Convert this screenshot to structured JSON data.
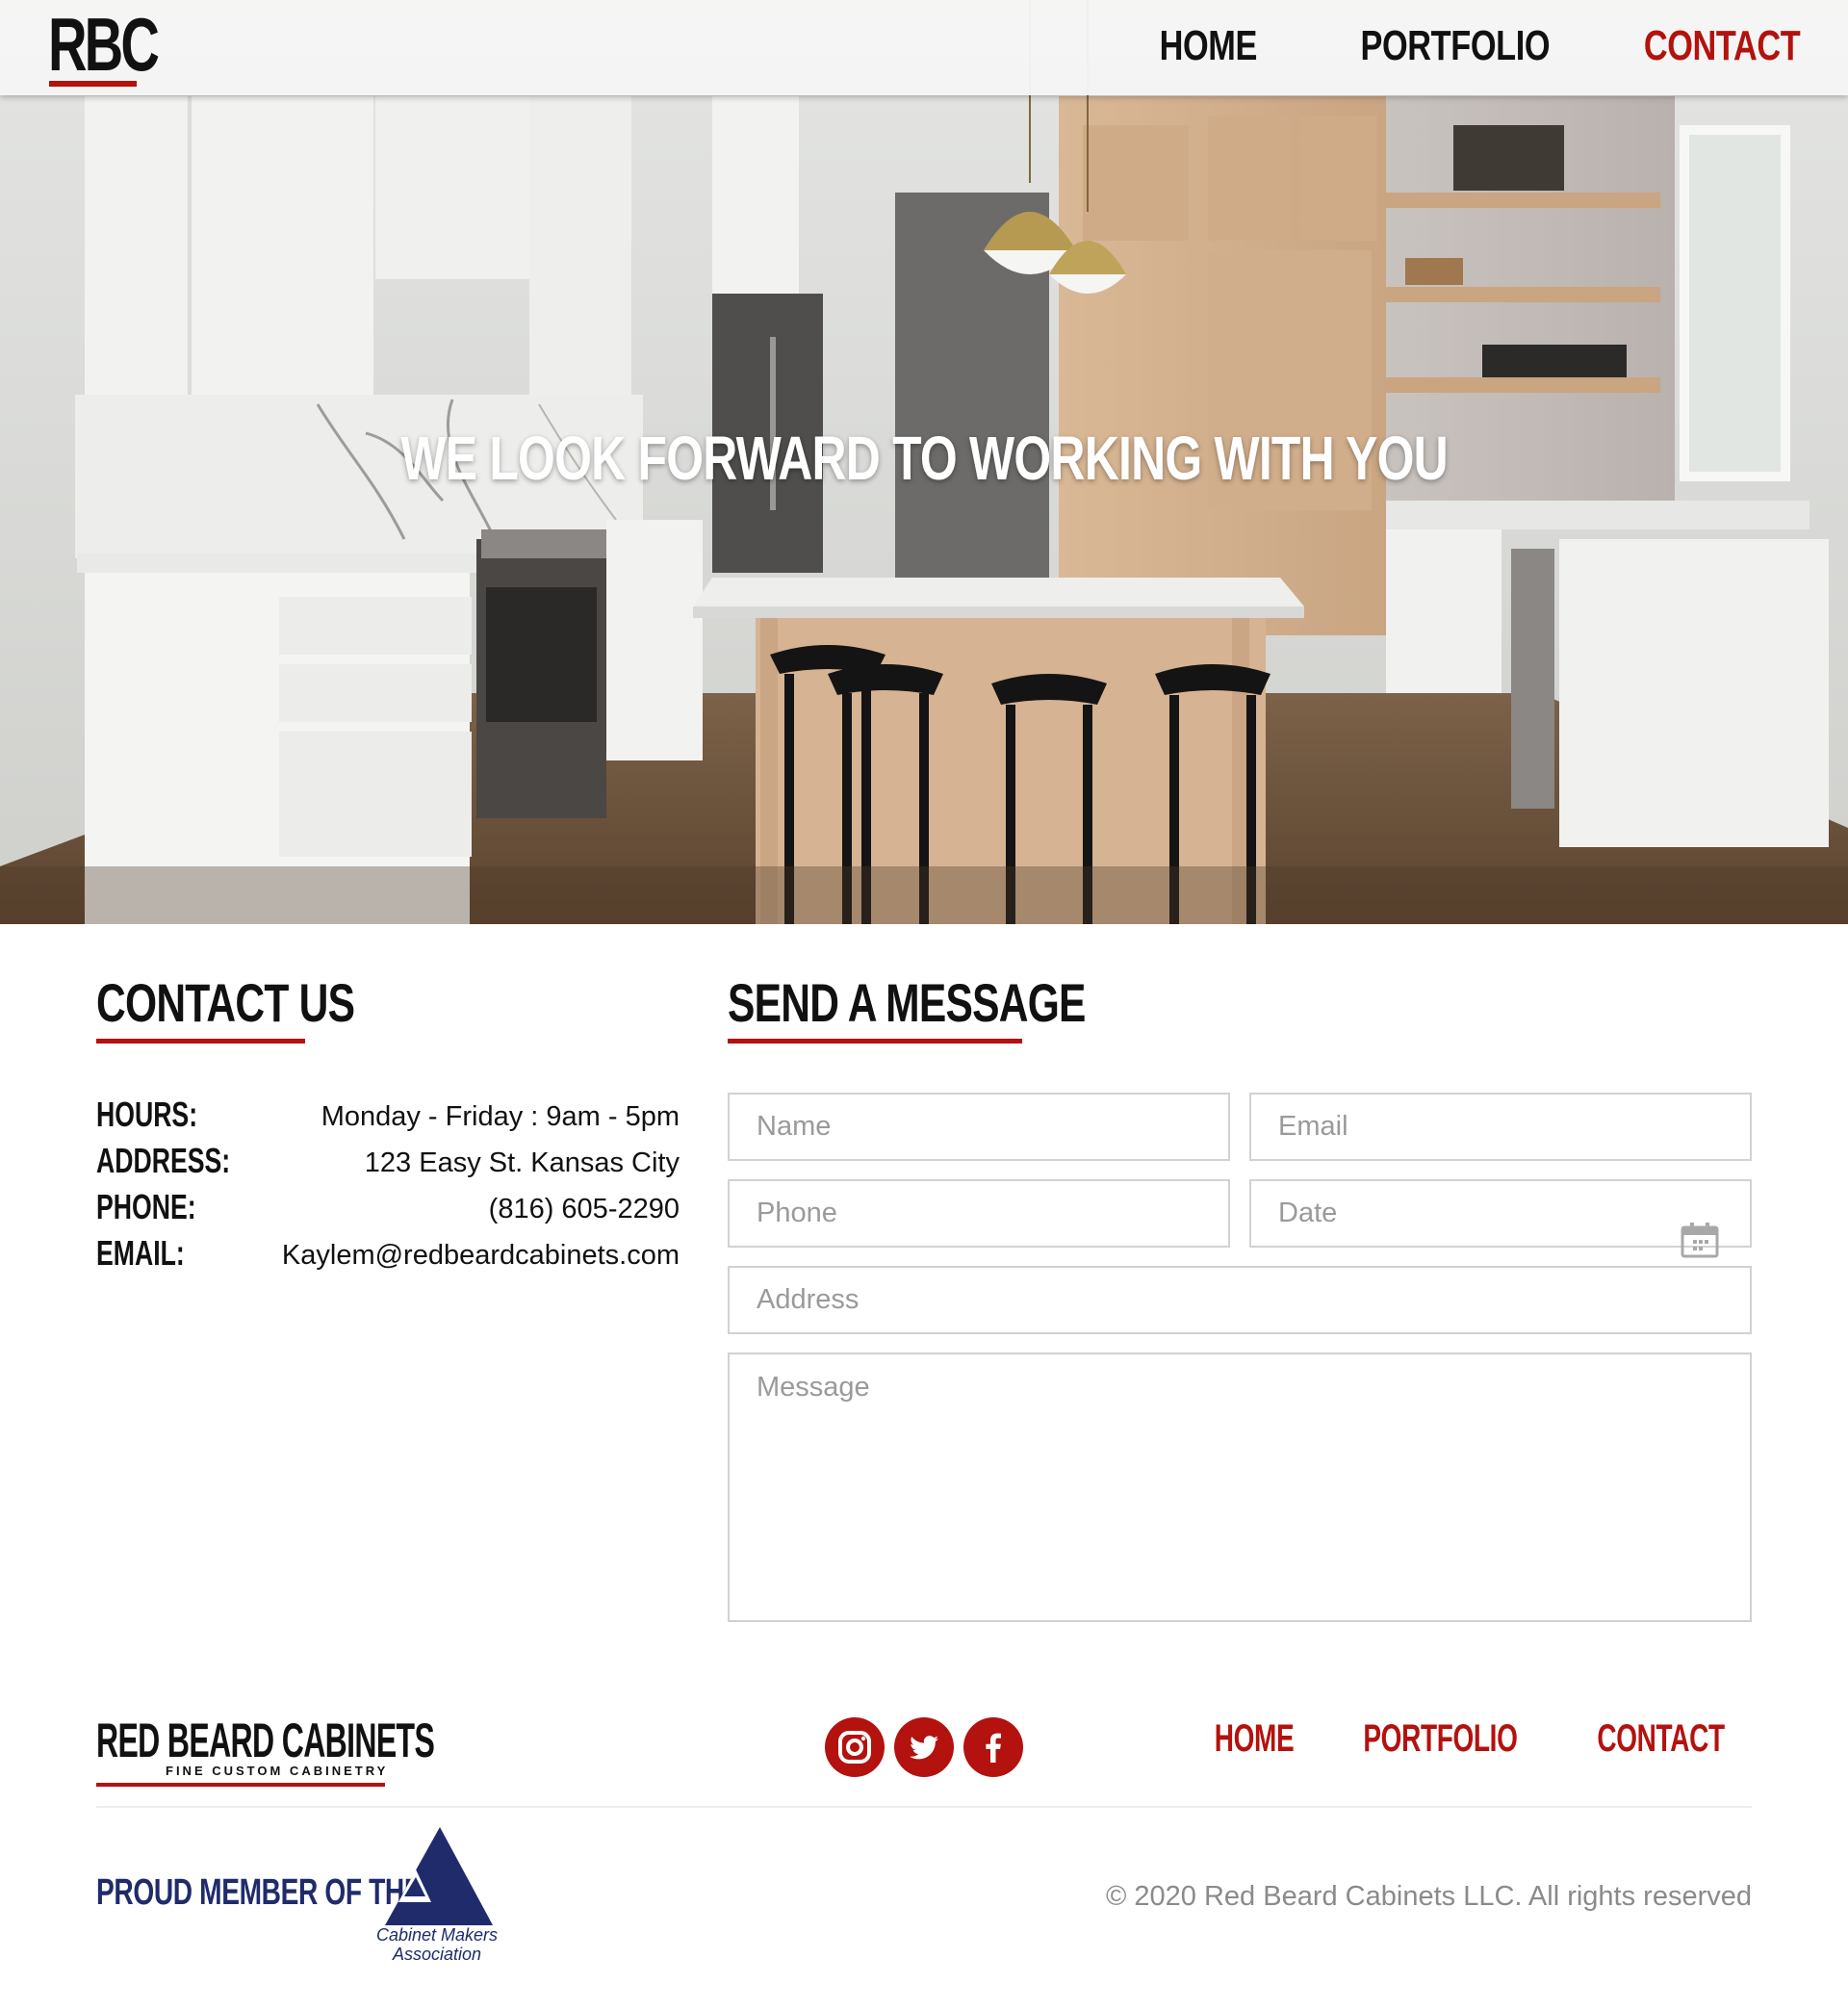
{
  "header": {
    "logo_text": "RBC",
    "nav": [
      {
        "label": "HOME",
        "active": false
      },
      {
        "label": "PORTFOLIO",
        "active": false
      },
      {
        "label": "CONTACT",
        "active": true
      }
    ]
  },
  "hero": {
    "title": "WE LOOK FORWARD TO WORKING WITH YOU"
  },
  "contact": {
    "heading": "CONTACT US",
    "rows": [
      {
        "label": "HOURS:",
        "value": "Monday - Friday : 9am - 5pm"
      },
      {
        "label": "ADDRESS:",
        "value": "123 Easy St. Kansas City"
      },
      {
        "label": "PHONE:",
        "value": "(816) 605-2290"
      },
      {
        "label": "EMAIL:",
        "value": "Kaylem@redbeardcabinets.com"
      }
    ]
  },
  "form": {
    "heading": "SEND A MESSAGE",
    "name_placeholder": "Name",
    "email_placeholder": "Email",
    "phone_placeholder": "Phone",
    "date_placeholder": "Date",
    "address_placeholder": "Address",
    "message_placeholder": "Message"
  },
  "footer": {
    "brand_name": "RED BEARD CABINETS",
    "brand_tagline": "FINE CUSTOM CABINETRY",
    "social": [
      "instagram-icon",
      "twitter-icon",
      "facebook-icon"
    ],
    "nav": [
      "HOME",
      "PORTFOLIO",
      "CONTACT"
    ],
    "proud_member": "PROUD MEMBER OF THE",
    "association_line1": "Cabinet Makers",
    "association_line2": "Association",
    "copyright": "© 2020 Red Beard Cabinets LLC. All rights reserved"
  },
  "colors": {
    "accent": "#b3120e",
    "navy": "#1f2b6b",
    "text": "#111111"
  }
}
